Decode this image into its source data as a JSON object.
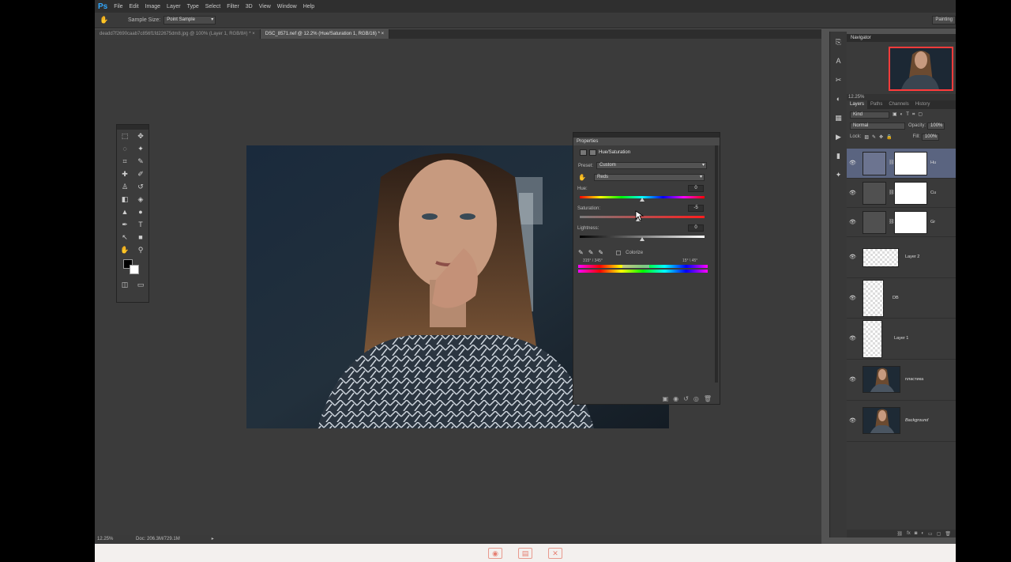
{
  "app": {
    "logo": "Ps",
    "menu": [
      "File",
      "Edit",
      "Image",
      "Layer",
      "Type",
      "Select",
      "Filter",
      "3D",
      "View",
      "Window",
      "Help"
    ]
  },
  "options": {
    "sample_size_label": "Sample Size:",
    "sample_size_value": "Point Sample",
    "workspace": "Painting"
  },
  "tabs": [
    {
      "label": "deadd7f2690caab7c856f1fd22675dm8.jpg @ 100% (Layer 1, RGB/8#) *",
      "close": "×"
    },
    {
      "label": "DSC_8571.nef @ 12.2% (Hue/Saturation 1, RGB/16) *",
      "close": "×"
    }
  ],
  "properties": {
    "panel_title": "Properties",
    "adjustment": "Hue/Saturation",
    "preset_label": "Preset:",
    "preset_value": "Custom",
    "channel_value": "Reds",
    "hue_label": "Hue:",
    "hue_value": "0",
    "saturation_label": "Saturation:",
    "saturation_value": "-5",
    "lightness_label": "Lightness:",
    "lightness_value": "0",
    "colorize_label": "Colorize",
    "range_left": "315° / 345°",
    "range_right": "15° \\ 45°",
    "hue_level": 0.5,
    "saturation_level": 0.47,
    "lightness_level": 0.5
  },
  "navigator": {
    "title": "Navigator",
    "zoom": "12.25%"
  },
  "layers": {
    "tabs": [
      "Layers",
      "Paths",
      "Channels",
      "History"
    ],
    "kind_label": "Kind",
    "blend_mode": "Normal",
    "opacity_label": "Opacity:",
    "opacity_value": "100%",
    "lock_label": "Lock:",
    "fill_label": "Fill:",
    "fill_value": "100%",
    "items": [
      {
        "name": "Hu",
        "type": "adjustment"
      },
      {
        "name": "Cu",
        "type": "adjustment"
      },
      {
        "name": "Gr",
        "type": "adjustment"
      },
      {
        "name": "Layer 2",
        "type": "transparent"
      },
      {
        "name": "DB",
        "type": "transparent"
      },
      {
        "name": "Layer 1",
        "type": "transparent"
      },
      {
        "name": "пластика",
        "type": "photo"
      },
      {
        "name": "Background",
        "type": "photo"
      }
    ]
  },
  "status": {
    "zoom": "12.25%",
    "doc": "Doc: 206.3M/729.1M"
  },
  "colors": {
    "accent": "#31a8ff",
    "selection": "#5a6480",
    "navigator_frame": "#ff3b3b"
  }
}
